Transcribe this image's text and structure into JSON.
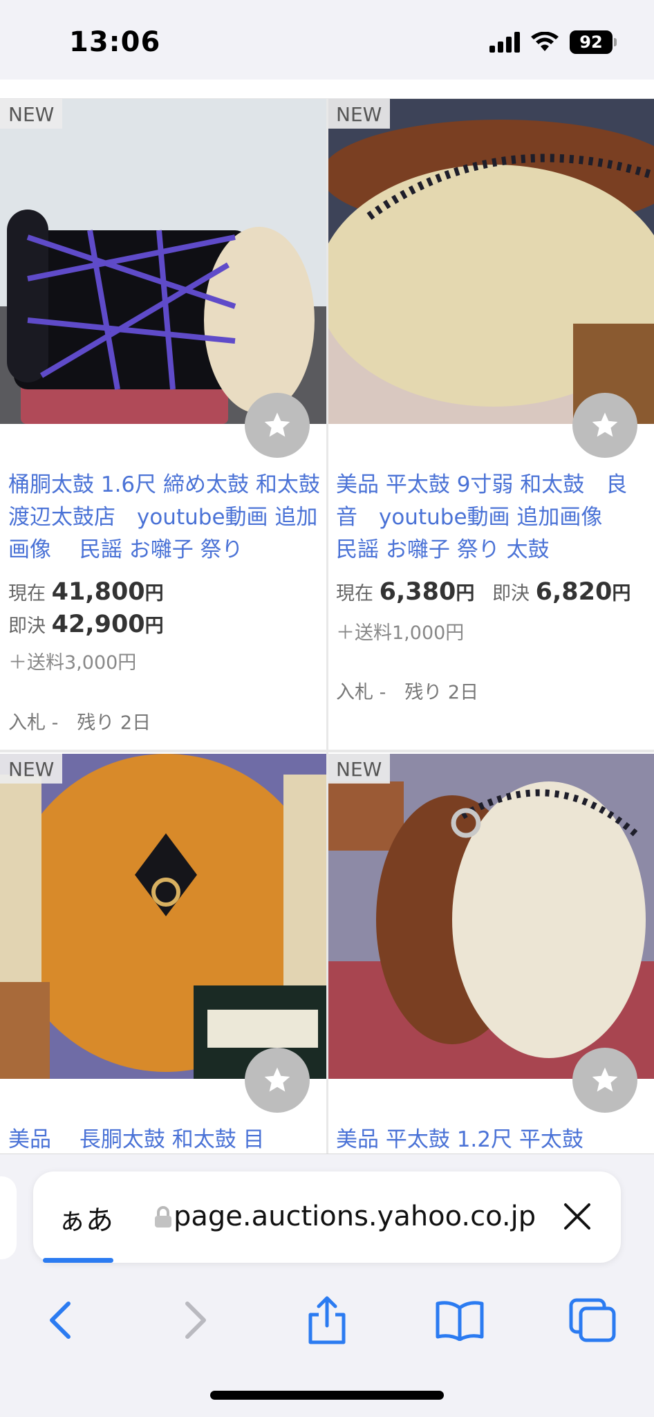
{
  "status_bar": {
    "time": "13:06",
    "battery": "92"
  },
  "listings": [
    {
      "badge": "NEW",
      "title": "桶胴太鼓 1.6尺 締め太鼓 和太鼓 渡辺太鼓店　youtube動画 追加画像　 民謡 お囃子 祭り",
      "current_label": "現在",
      "current_price": "41,800",
      "yen": "円",
      "buy_label": "即決",
      "buy_price": "42,900",
      "shipping": "＋送料3,000円",
      "bids": "入札 -　残り 2日"
    },
    {
      "badge": "NEW",
      "title": "美品 平太鼓 9寸弱 和太鼓　良音　youtube動画 追加画像　 民謡 お囃子 祭り 太鼓",
      "current_label": "現在",
      "current_price": "6,380",
      "yen": "円",
      "buy_label": "即決",
      "buy_price": "6,820",
      "shipping": "＋送料1,000円",
      "bids": "入札 -　残り 2日"
    },
    {
      "badge": "NEW",
      "title": "美品　 長胴太鼓 和太鼓 目"
    },
    {
      "badge": "NEW",
      "title": "美品 平太鼓 1.2尺 平太鼓"
    }
  ],
  "browser": {
    "aa_label": "ぁあ",
    "url": "page.auctions.yahoo.co.jp",
    "accent": "#2b7bf1"
  },
  "icons": [
    "signal-icon",
    "wifi-icon",
    "star-icon",
    "lock-icon",
    "close-icon",
    "back-icon",
    "forward-icon",
    "share-icon",
    "bookmarks-icon",
    "tabs-icon"
  ]
}
